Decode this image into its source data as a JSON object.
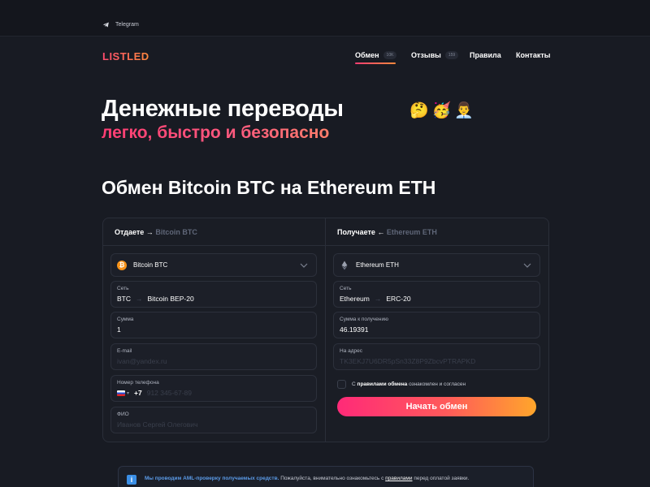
{
  "topbar": {
    "telegram_label": "Telegram"
  },
  "header": {
    "logo": "LISTLED",
    "nav": [
      {
        "label": "Обмен",
        "badge": "10K",
        "active": true
      },
      {
        "label": "Отзывы",
        "badge": "159"
      },
      {
        "label": "Правила"
      },
      {
        "label": "Контакты"
      }
    ]
  },
  "hero": {
    "title": "Денежные переводы",
    "emojis": [
      "🤔",
      "🥳",
      "👨‍💼"
    ],
    "subtitle": "легко, быстро и безопасно"
  },
  "exchange": {
    "title": "Обмен Bitcoin BTC на Ethereum ETH",
    "give": {
      "heading": "Отдаете →",
      "heading_currency": "Bitcoin BTC",
      "currency": "Bitcoin BTC",
      "network_label": "Сеть",
      "network_from": "BTC",
      "network_arrow": "→",
      "network_to": "Bitcoin BEP-20",
      "amount_label": "Сумма",
      "amount_value": "1",
      "email_label": "E-mail",
      "email_placeholder": "ivan@yandex.ru",
      "phone_label": "Номер телефона",
      "phone_code": "+7",
      "phone_placeholder": "912 345-67-89",
      "fio_label": "ФИО",
      "fio_placeholder": "Иванов Сергей Олегович"
    },
    "receive": {
      "heading": "Получаете ←",
      "heading_currency": "Ethereum ETH",
      "currency": "Ethereum ETH",
      "network_label": "Сеть",
      "network_from": "Ethereum",
      "network_arrow": "→",
      "network_to": "ERC-20",
      "amount_label": "Сумма к получению",
      "amount_value": "46.19391",
      "address_label": "На адрес",
      "address_placeholder": "TK3EKJ7U6DR5pSn33Z8P9ZbcvPTRAPKD"
    },
    "agree": {
      "prefix": "С",
      "link": "правилами обмена",
      "suffix": "ознакомлен и согласен"
    },
    "submit_label": "Начать обмен"
  },
  "notice": {
    "aml": "Мы проводим AML-проверку получаемых средств.",
    "text": "Пожалуйста, внимательно ознакомьтесь с",
    "link": "правилами",
    "tail": "перед оплатой заявки."
  },
  "colors": {
    "background": "#181b23",
    "accent_pink": "#ff3d73",
    "accent_orange": "#ffa62b",
    "bitcoin": "#f7931a",
    "info_blue": "#3b8fe6"
  },
  "icons": [
    "telegram-icon",
    "bitcoin-icon",
    "ethereum-icon",
    "chevron-down-icon",
    "info-icon",
    "ru-flag-icon"
  ]
}
